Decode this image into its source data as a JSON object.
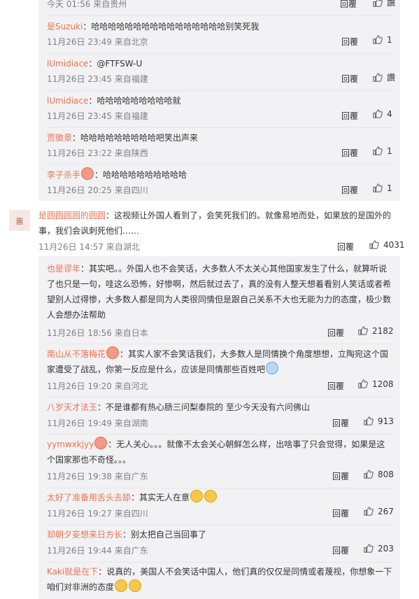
{
  "icons": {
    "like": "thumbs-up-outline"
  },
  "top_replies": [
    {
      "meta": "今天 01:56 来自贵州",
      "reply": "回覆",
      "likes": "讚"
    },
    {
      "name": "是Suzuki",
      "text": "：哈哈哈哈哈哈哈哈哈哈哈哈哈哈哈哈别笑死我",
      "meta": "11月26日 23:49 来自北京",
      "reply": "回覆",
      "likes": "1"
    },
    {
      "name": "lUmidiace",
      "text": "：@FTFSW-U",
      "meta": "11月26日 23:45 来自福建",
      "reply": "回覆",
      "likes": "讚"
    },
    {
      "name": "lUmidiace",
      "text": "：哈哈哈哈哈哈哈哈哈就",
      "meta": "11月26日 23:45 来自福建",
      "reply": "回覆",
      "likes": "4"
    },
    {
      "name": "贾徵景",
      "text": "：哈哈哈哈哈哈哈哈哈吧笑出声来",
      "meta": "11月26日 23:22 来自陕西",
      "reply": "回覆",
      "likes": "1"
    },
    {
      "name": "李子杀手",
      "text": "：哈哈哈哈哈哈哈哈哈哈",
      "meta": "11月26日 20:25 来自四川",
      "reply": "回覆",
      "likes": "1"
    }
  ],
  "main": {
    "avatar_text": "圖",
    "name": "是圆圆圆圆的圆圆",
    "text": "：这视频让外国人看到了，会笑死我们的。就像易地而处，如果放的是国外的事，我们会讽刺死他们……",
    "meta": "11月26日 14:57 来自湖北",
    "reply": "回覆",
    "likes": "4031"
  },
  "bottom_replies": [
    {
      "name": "也是谬年",
      "text": "：其实吧。。外国人也不会笑话，大多数人不太关心其他国家发生了什么，就算听说了也只是一句，哇这么恐怖，好惨啊，然后就过去了，真的没有人整天想着看别人笑话或者希望别人过得惨，大多数人都是同为人类很同情但是跟自己关系不大也无能为力的态度，极少数人会想办法帮助",
      "meta": "11月26日 18:56 来自日本",
      "reply": "回覆",
      "likes": "2182"
    },
    {
      "name": "南山从不落梅花",
      "text": "：其实人家不会笑话我们，大多数人是同情换个角度想想，立陶宛这个国家遭受了战乱，你第一反应是什么，应该是同情那些百姓吧",
      "meta": "11月26日 19:20 来自河北",
      "reply": "回覆",
      "likes": "1208"
    },
    {
      "name": "八岁天才法王",
      "text": "：不是谁都有热心肠三问梨泰院的 至少今天没有六问佛山",
      "meta": "11月26日 19:49 来自湖南",
      "reply": "回覆",
      "likes": "913"
    },
    {
      "name": "yymwxkjyy",
      "text": "：无人关心。。。就像不太会关心朝鲜怎么样，出啥事了只会觉得，如果是这个国家那也不奇怪。。。",
      "meta": "11月26日 19:38 来自广东",
      "reply": "回覆",
      "likes": "808"
    },
    {
      "name": "太好了准备用舌头去舔",
      "text": "：其实无人在意",
      "meta": "11月26日 19:27 来自四川",
      "reply": "回覆",
      "likes": "267"
    },
    {
      "name": "却朝夕妄想来日方长",
      "text": "：别太把自己当回事了",
      "meta": "11月26日 19:44 来自广东",
      "reply": "回覆",
      "likes": "203"
    },
    {
      "name": "Kaki就是在下",
      "text": "：说真的，美国人不会笑话中国人，他们真的仅仅是同情或者蔑视，你想象一下咱们对非洲的态度"
    }
  ]
}
